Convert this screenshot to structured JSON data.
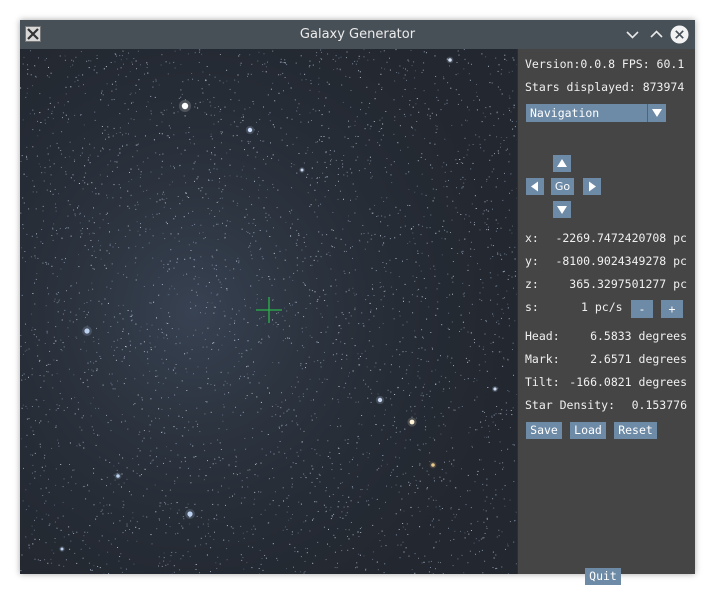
{
  "window": {
    "title": "Galaxy Generator",
    "app_icon": "x-app-icon",
    "controls": [
      "chevron-down-icon",
      "chevron-up-icon",
      "close-icon"
    ]
  },
  "viewport": {
    "background_color": "#242a33",
    "crosshair_color": "#2bb24a",
    "crosshair_icon": "crosshair-icon"
  },
  "panel": {
    "version_line": "Version:0.0.8 FPS: 60.1",
    "stars_line": "Stars displayed: 873974",
    "mode_select": {
      "value": "Navigation",
      "icon": "caret-down-icon"
    },
    "nav": {
      "go_label": "Go",
      "up_icon": "arrow-up-icon",
      "down_icon": "arrow-down-icon",
      "left_icon": "arrow-left-icon",
      "right_icon": "arrow-right-icon"
    },
    "coords": [
      {
        "label": "x:",
        "value": "-2269.7472420708 pc"
      },
      {
        "label": "y:",
        "value": "-8100.9024349278 pc"
      },
      {
        "label": "z:",
        "value": "365.3297501277 pc"
      }
    ],
    "speed": {
      "label": "s:",
      "value": "1 pc/s",
      "minus_label": "-",
      "plus_label": "+"
    },
    "orientation": [
      {
        "label": "Head:",
        "value": "6.5833 degrees"
      },
      {
        "label": "Mark:",
        "value": "2.6571 degrees"
      },
      {
        "label": "Tilt:",
        "value": "-166.0821 degrees"
      }
    ],
    "density": {
      "label": "Star Density:",
      "value": "0.153776"
    },
    "buttons": {
      "save": "Save",
      "load": "Load",
      "reset": "Reset",
      "quit": "Quit"
    },
    "button_color": "#6d8aa6"
  }
}
